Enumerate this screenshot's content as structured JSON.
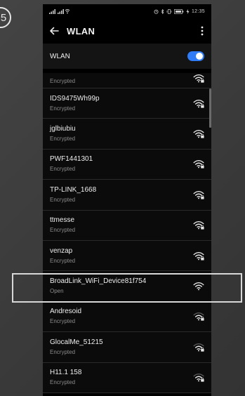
{
  "step_number": "5",
  "status_bar": {
    "left": "³⁺ᴵₗₗ ³⁺ᴵₗₗ ≅",
    "right_icons": "⏰ ✱ ▯ ▇▇ ⚡",
    "time": "12:35"
  },
  "app_bar": {
    "title": "WLAN"
  },
  "wlan_toggle": {
    "label": "WLAN",
    "state": "on",
    "accent": "#2f7cf6"
  },
  "networks": [
    {
      "name": "",
      "status": "Encrypted",
      "signal": 3,
      "locked": true
    },
    {
      "name": "IDS9475Wh99p",
      "status": "Encrypted",
      "signal": 3,
      "locked": true
    },
    {
      "name": "jglbiubiu",
      "status": "Encrypted",
      "signal": 3,
      "locked": true
    },
    {
      "name": "PWF1441301",
      "status": "Encrypted",
      "signal": 3,
      "locked": true
    },
    {
      "name": "TP-LINK_1668",
      "status": "Encrypted",
      "signal": 3,
      "locked": true
    },
    {
      "name": "ttmesse",
      "status": "Encrypted",
      "signal": 3,
      "locked": true
    },
    {
      "name": "venzap",
      "status": "Encrypted",
      "signal": 3,
      "locked": true
    },
    {
      "name": "BroadLink_WiFi_Device81f754",
      "status": "Open",
      "signal": 3,
      "locked": false
    },
    {
      "name": "Andresoid",
      "status": "Encrypted",
      "signal": 2,
      "locked": true
    },
    {
      "name": "GlocalMe_51215",
      "status": "Encrypted",
      "signal": 2,
      "locked": true
    },
    {
      "name": "H11.1 158",
      "status": "Encrypted",
      "signal": 2,
      "locked": true
    }
  ],
  "highlighted_network": "BroadLink_WiFi_Device81f754"
}
